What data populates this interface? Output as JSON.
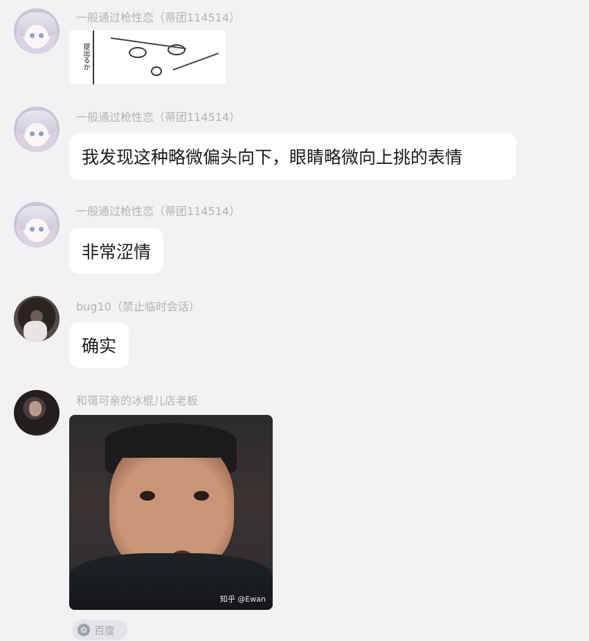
{
  "messages": [
    {
      "sender": "一般通过枪性恋（蒂团114514）",
      "type": "image"
    },
    {
      "sender": "一般通过枪性恋（蒂团114514）",
      "text": "我发现这种略微偏头向下，眼睛略微向上挑的表情"
    },
    {
      "sender": "一般通过枪性恋（蒂团114514）",
      "text": "非常涩情"
    },
    {
      "sender": "bug10（禁止临时会话）",
      "text": "确实"
    },
    {
      "sender": "和蔼可亲的冰棍儿店老板",
      "type": "image",
      "watermark": "知乎 @Ewan"
    }
  ],
  "manga_text": "提出るか",
  "reaction": {
    "label": "百度",
    "icon": "flower-icon"
  }
}
